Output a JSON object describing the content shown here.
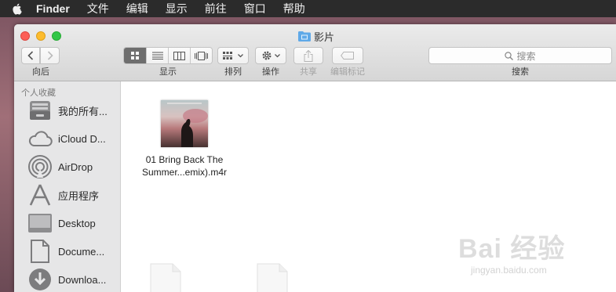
{
  "menubar": {
    "app": "Finder",
    "items": [
      "文件",
      "编辑",
      "显示",
      "前往",
      "窗口",
      "帮助"
    ]
  },
  "window": {
    "title": "影片",
    "toolbar": {
      "back_forward_label": "向后",
      "view_label": "显示",
      "arrange_label": "排列",
      "action_label": "操作",
      "share_label": "共享",
      "tags_label": "编辑标记",
      "search_placeholder": "搜索",
      "search_label": "搜索",
      "active_view": "icon"
    },
    "sidebar": {
      "heading": "个人收藏",
      "items": [
        {
          "label": "我的所有...",
          "icon": "all-files-icon"
        },
        {
          "label": "iCloud D...",
          "icon": "icloud-icon"
        },
        {
          "label": "AirDrop",
          "icon": "airdrop-icon"
        },
        {
          "label": "应用程序",
          "icon": "applications-icon"
        },
        {
          "label": "Desktop",
          "icon": "desktop-icon"
        },
        {
          "label": "Docume...",
          "icon": "documents-icon"
        },
        {
          "label": "Downloa...",
          "icon": "downloads-icon"
        }
      ]
    },
    "files": [
      {
        "line1": "01 Bring Back The",
        "line2": "Summer...emix).m4r",
        "icon": "audio-file-thumbnail"
      }
    ]
  },
  "watermark": {
    "text": "Bai 经验",
    "sub": "jingyan.baidu.com"
  },
  "colors": {
    "close": "#fc5f57",
    "minimize": "#fdbc2e",
    "maximize": "#33c748",
    "menubar": "#2b2b2b",
    "sidebar": "#e6e6e7"
  }
}
